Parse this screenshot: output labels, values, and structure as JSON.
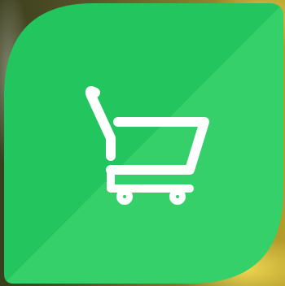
{
  "app_icon": {
    "name": "shopping-cart-app-icon",
    "colors": {
      "leaf_dark": "#22c55e",
      "leaf_light": "#36d06a",
      "glyph": "#ffffff",
      "backdrop": "#6b6530"
    },
    "icon": "shopping-cart-icon"
  }
}
